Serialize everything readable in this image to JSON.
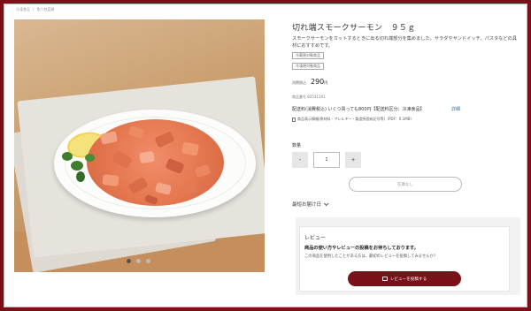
{
  "breadcrumb": {
    "items": [
      "冷凍食品",
      "/",
      "魚介惣菜類"
    ]
  },
  "product": {
    "title": "切れ端スモークサーモン　９５ｇ",
    "description": "スモークサーモンをカットするときに出る切れ端部分を集めました。サラダやサンドイッチ、パスタなどの具材におすすめです。",
    "tags": [
      "冷蔵便対象商品",
      "冷凍便対象商品"
    ],
    "price_label": "消費税込",
    "price": "290",
    "price_unit": "円",
    "code_label": "商品番号",
    "code": "82531341",
    "shipping_text": "配送料(消費税込) いくつ買っても800円【配送料区分：冷凍食品】",
    "shipping_link": "詳細",
    "pdf_text": "商品表示情報(原材料・アレルギー・製造所固有記号等)（PDF：0.1MB）"
  },
  "gallery": {
    "dot_count": 3,
    "active_dot": 0
  },
  "quantity": {
    "label": "数量",
    "minus": "-",
    "value": "1",
    "plus": "+"
  },
  "cart": {
    "button_label": "在庫なし"
  },
  "delivery": {
    "label": "最短お届け日"
  },
  "review": {
    "title": "レビュー",
    "headline": "商品の使い方やレビューの投稿をお待ちしております。",
    "subtext": "この商品を使用したことがある方は、最初のレビューを投稿してみませんか？",
    "button_label": "レビューを投稿する"
  },
  "colors": {
    "accent": "#7a1018",
    "link": "#3a6ea5"
  }
}
